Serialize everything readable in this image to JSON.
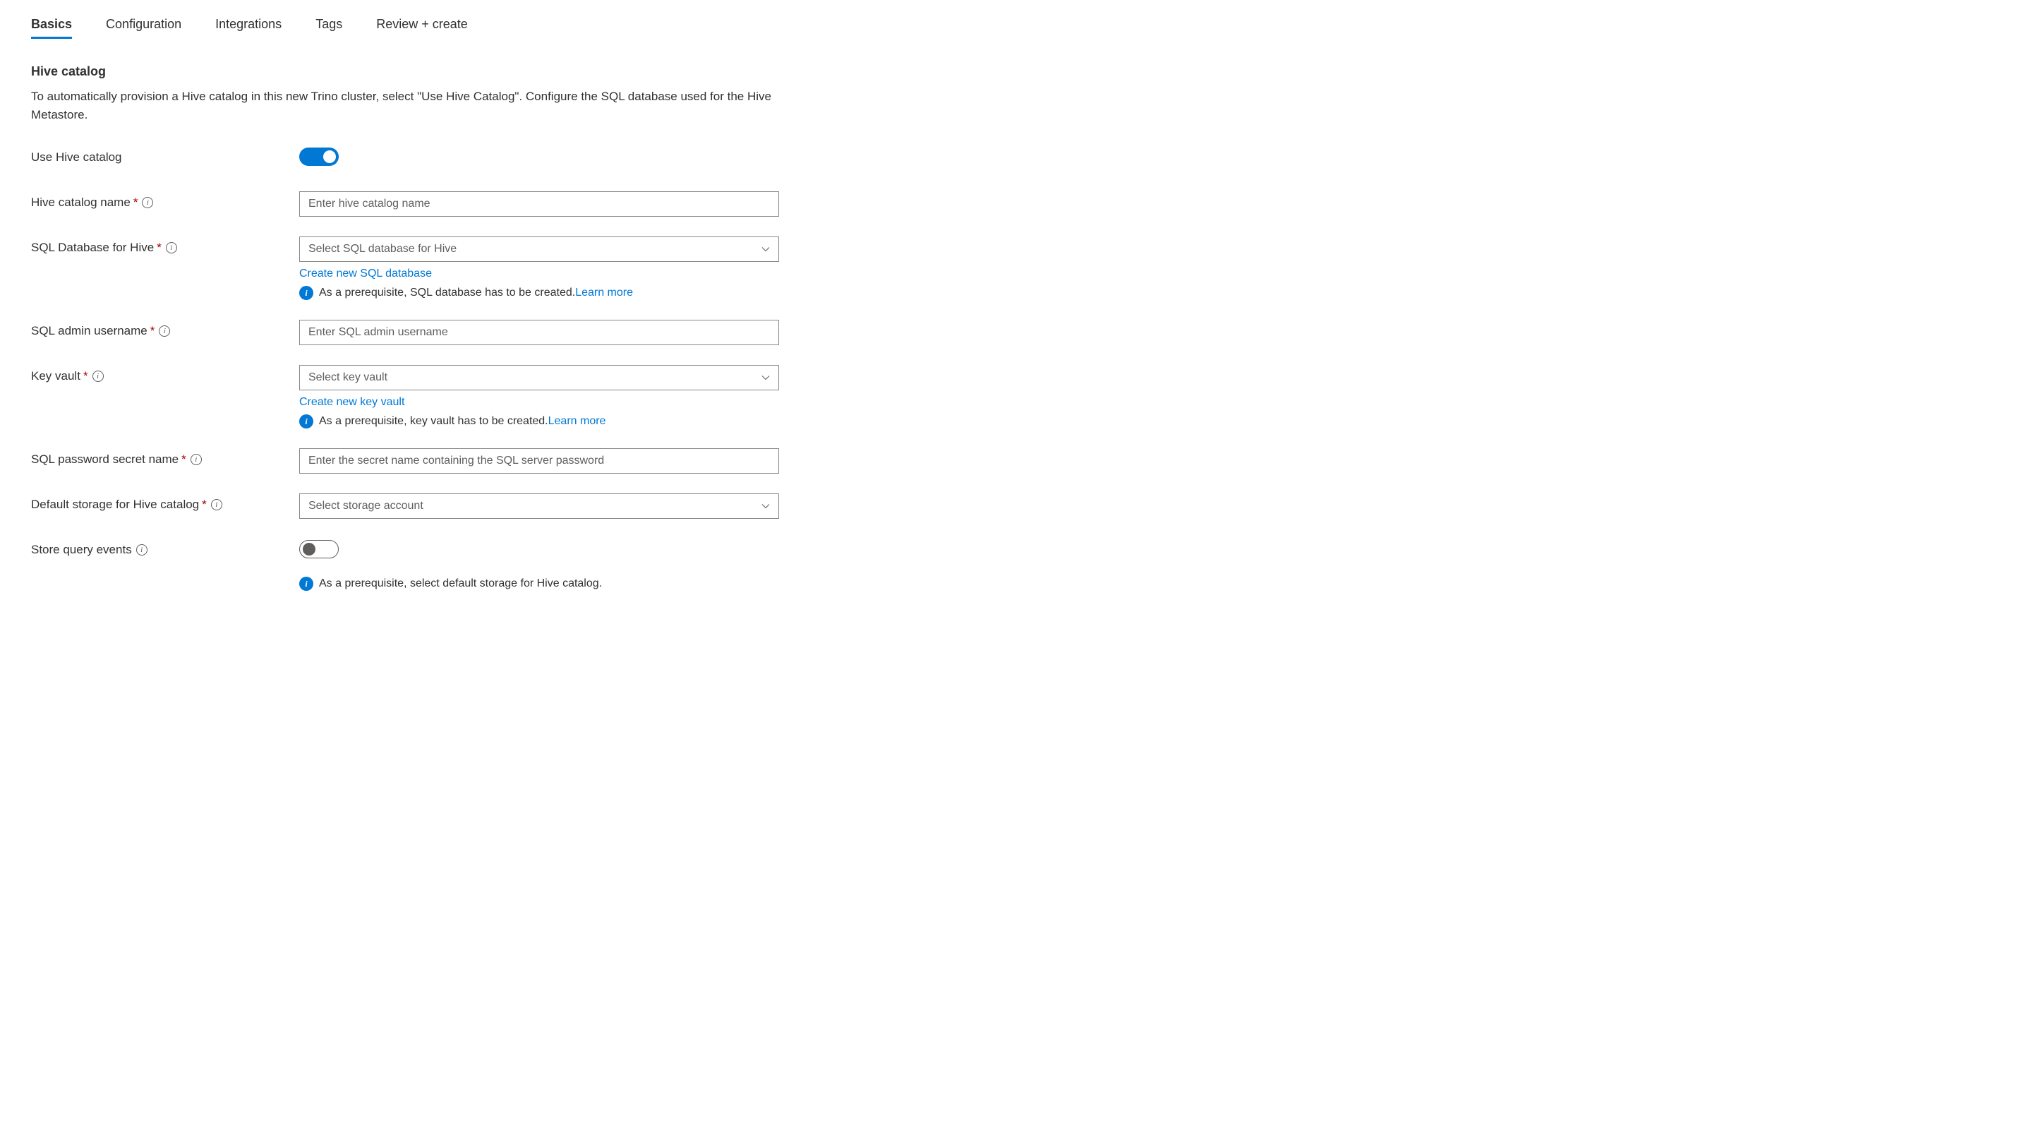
{
  "tabs": {
    "basics": "Basics",
    "configuration": "Configuration",
    "integrations": "Integrations",
    "tags": "Tags",
    "review_create": "Review + create"
  },
  "section": {
    "title": "Hive catalog",
    "desc": "To automatically provision a Hive catalog in this new Trino cluster, select \"Use Hive Catalog\". Configure the SQL database used for the Hive Metastore."
  },
  "fields": {
    "use_hive_catalog": {
      "label": "Use Hive catalog",
      "on": true
    },
    "hive_catalog_name": {
      "label": "Hive catalog name",
      "placeholder": "Enter hive catalog name"
    },
    "sql_db": {
      "label": "SQL Database for Hive",
      "placeholder": "Select SQL database for Hive",
      "create_link": "Create new SQL database",
      "prereq_text": "As a prerequisite, SQL database has to be created.",
      "learn_more": "Learn more"
    },
    "sql_admin_username": {
      "label": "SQL admin username",
      "placeholder": "Enter SQL admin username"
    },
    "key_vault": {
      "label": "Key vault",
      "placeholder": "Select key vault",
      "create_link": "Create new key vault",
      "prereq_text": "As a prerequisite, key vault has to be created.",
      "learn_more": "Learn more"
    },
    "sql_password_secret": {
      "label": "SQL password secret name",
      "placeholder": "Enter the secret name containing the SQL server password"
    },
    "default_storage": {
      "label": "Default storage for Hive catalog",
      "placeholder": "Select storage account"
    },
    "store_query_events": {
      "label": "Store query events",
      "on": false,
      "prereq_text": "As a prerequisite, select default storage for Hive catalog."
    }
  }
}
